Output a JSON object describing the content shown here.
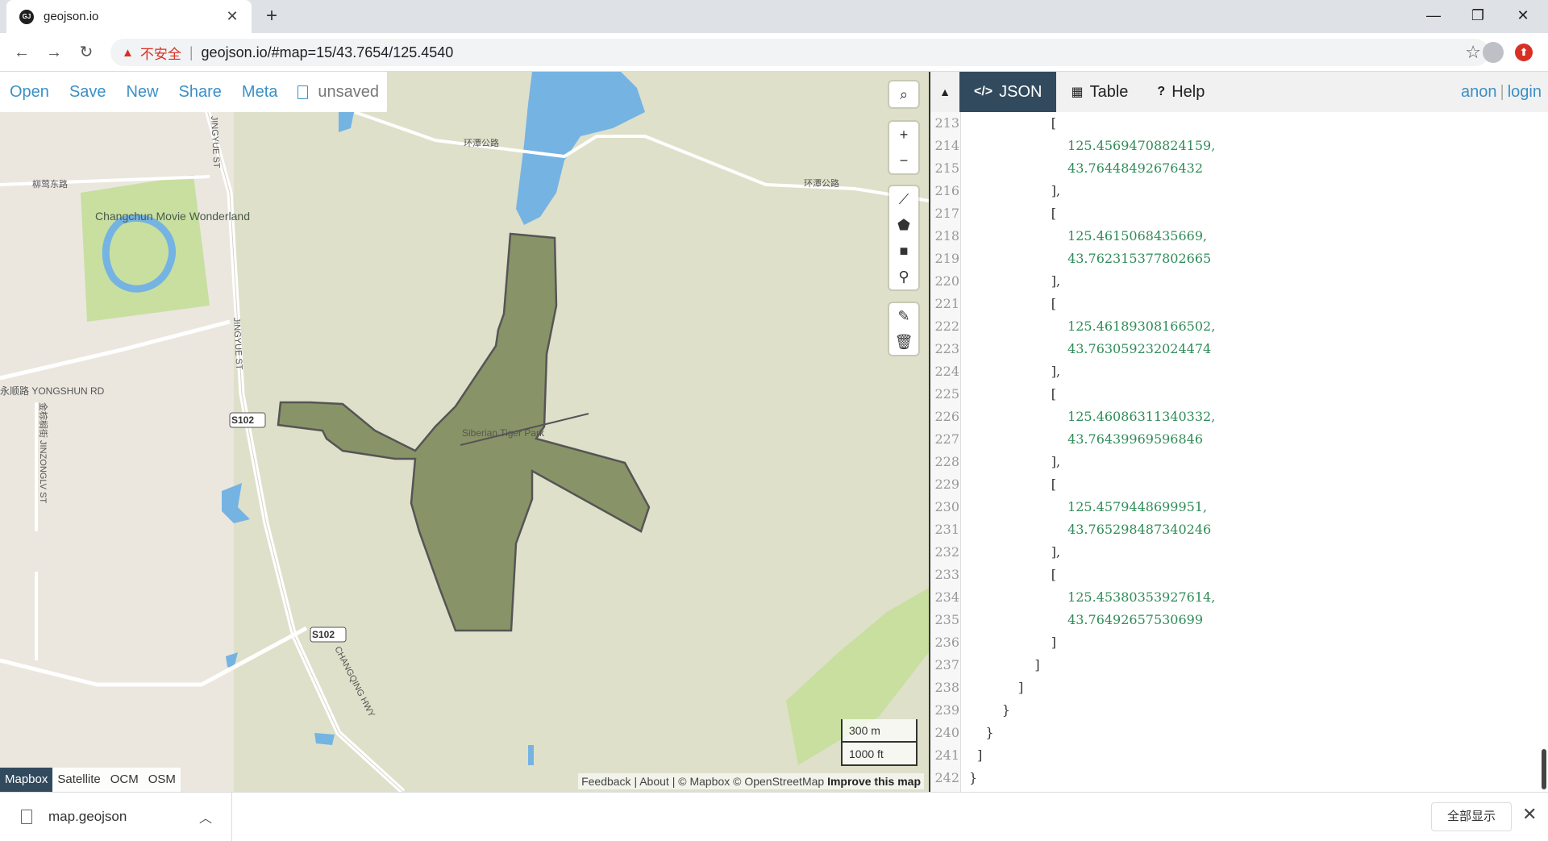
{
  "browser": {
    "tab_title": "geojson.io",
    "favicon_text": "GJ",
    "tab_close": "✕",
    "new_tab": "+",
    "insecure_label": "不安全",
    "url": "geojson.io/#map=15/43.7654/125.4540",
    "window_controls": {
      "minimize": "—",
      "maximize": "❐",
      "close": "✕"
    }
  },
  "menu": {
    "open": "Open",
    "save": "Save",
    "new": "New",
    "share": "Share",
    "meta": "Meta",
    "status": "unsaved"
  },
  "map": {
    "labels": {
      "park": "Changchun Movie Wonderland",
      "road_jingyue": "JINGYUE ST",
      "road_yongshun": "永顺路 YONGSHUN RD",
      "road_jinzonglv": "金棕榈街 JINZONGLV ST",
      "road_s102": "S102",
      "road_changqing": "CHANGQING HWY",
      "road_huantan": "环潭公路",
      "road_liuying": "柳莺东路",
      "poi_tiger": "Siberian Tiger Park"
    },
    "scale": {
      "metric": "300 m",
      "imperial": "1000 ft"
    },
    "layers": [
      "Mapbox",
      "Satellite",
      "OCM",
      "OSM"
    ],
    "active_layer": "Mapbox",
    "attribution": {
      "feedback": "Feedback",
      "about": "About",
      "mapbox": "© Mapbox",
      "osm": "© OpenStreetMap",
      "improve": "Improve this map"
    },
    "polygon_color": "#6b7b45"
  },
  "pane": {
    "tabs": {
      "json": "JSON",
      "table": "Table",
      "help": "Help"
    },
    "active_tab": "JSON",
    "user": {
      "anon": "anon",
      "login": "login"
    }
  },
  "code_lines": [
    {
      "n": "213",
      "t": "                    [",
      "num": false
    },
    {
      "n": "214",
      "t": "                        125.45694708824159,",
      "num": true
    },
    {
      "n": "215",
      "t": "                        43.76448492676432",
      "num": true
    },
    {
      "n": "216",
      "t": "                    ],",
      "num": false
    },
    {
      "n": "217",
      "t": "                    [",
      "num": false
    },
    {
      "n": "218",
      "t": "                        125.4615068435669,",
      "num": true
    },
    {
      "n": "219",
      "t": "                        43.762315377802665",
      "num": true
    },
    {
      "n": "220",
      "t": "                    ],",
      "num": false
    },
    {
      "n": "221",
      "t": "                    [",
      "num": false
    },
    {
      "n": "222",
      "t": "                        125.46189308166502,",
      "num": true
    },
    {
      "n": "223",
      "t": "                        43.763059232024474",
      "num": true
    },
    {
      "n": "224",
      "t": "                    ],",
      "num": false
    },
    {
      "n": "225",
      "t": "                    [",
      "num": false
    },
    {
      "n": "226",
      "t": "                        125.46086311340332,",
      "num": true
    },
    {
      "n": "227",
      "t": "                        43.76439969596846",
      "num": true
    },
    {
      "n": "228",
      "t": "                    ],",
      "num": false
    },
    {
      "n": "229",
      "t": "                    [",
      "num": false
    },
    {
      "n": "230",
      "t": "                        125.4579448699951,",
      "num": true
    },
    {
      "n": "231",
      "t": "                        43.765298487340246",
      "num": true
    },
    {
      "n": "232",
      "t": "                    ],",
      "num": false
    },
    {
      "n": "233",
      "t": "                    [",
      "num": false
    },
    {
      "n": "234",
      "t": "                        125.45380353927614,",
      "num": true
    },
    {
      "n": "235",
      "t": "                        43.76492657530699",
      "num": true
    },
    {
      "n": "236",
      "t": "                    ]",
      "num": false
    },
    {
      "n": "237",
      "t": "                ]",
      "num": false
    },
    {
      "n": "238",
      "t": "            ]",
      "num": false
    },
    {
      "n": "239",
      "t": "        }",
      "num": false
    },
    {
      "n": "240",
      "t": "    }",
      "num": false
    },
    {
      "n": "241",
      "t": "  ]",
      "num": false
    },
    {
      "n": "242",
      "t": "}",
      "num": false
    }
  ],
  "downloads": {
    "file_name": "map.geojson",
    "show_all": "全部显示",
    "close": "✕"
  }
}
